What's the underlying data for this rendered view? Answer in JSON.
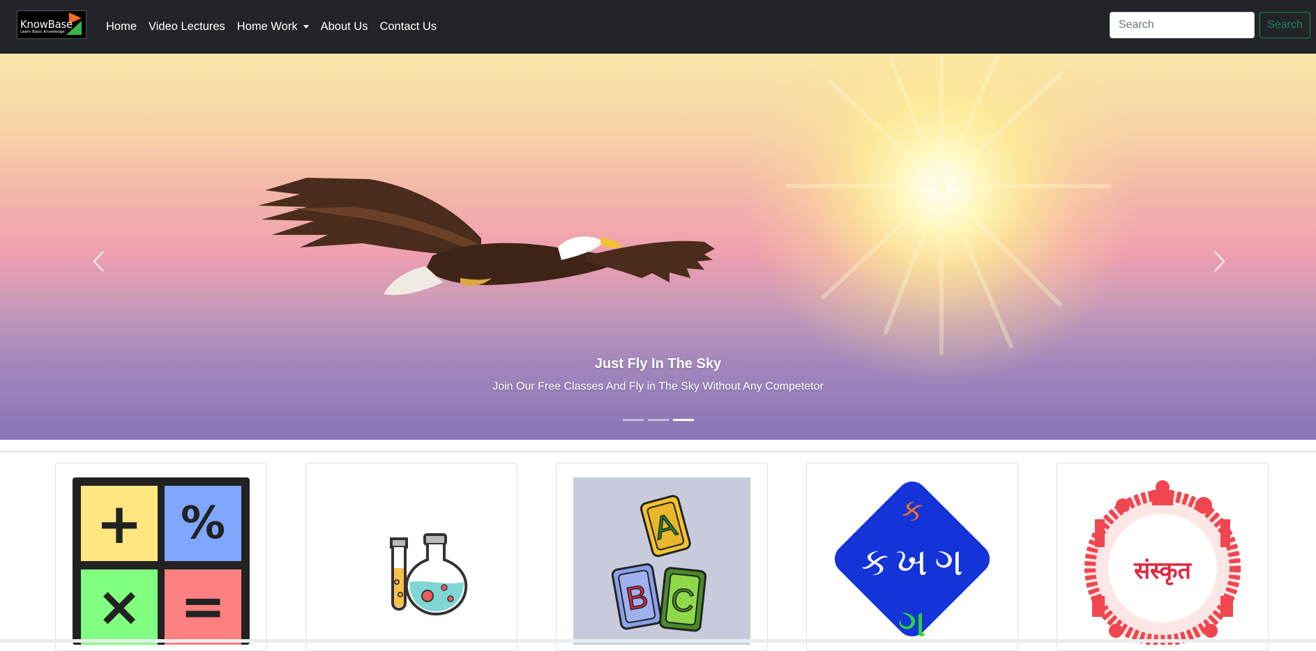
{
  "brand": {
    "name": "KnowBase",
    "tagline": "Learn Basic Knowledge",
    "colors": {
      "background": "#000000",
      "triangle_top": "#f36f21",
      "triangle_bottom": "#39b54a"
    }
  },
  "nav": {
    "items": [
      {
        "label": "Home",
        "dropdown": false
      },
      {
        "label": "Video Lectures",
        "dropdown": false
      },
      {
        "label": "Home Work",
        "dropdown": true
      },
      {
        "label": "About Us",
        "dropdown": false
      },
      {
        "label": "Contact Us",
        "dropdown": false
      }
    ]
  },
  "search": {
    "placeholder": "Search",
    "button_label": "Search"
  },
  "carousel": {
    "slide_title": "Just Fly In The Sky",
    "slide_text": "Join Our Free Classes And Fly in The Sky Without Any Competetor",
    "prev_icon": "chevron-left-icon",
    "next_icon": "chevron-right-icon",
    "indicator_count": 3,
    "active_indicator": 3
  },
  "cards": [
    {
      "subject_icon": "math-operators-icon",
      "glyphs": [
        "+",
        "%",
        "×",
        "="
      ]
    },
    {
      "subject_icon": "science-flasks-icon"
    },
    {
      "subject_icon": "abc-blocks-icon",
      "glyphs": [
        "A",
        "B",
        "C"
      ]
    },
    {
      "subject_icon": "gujarati-letters-icon",
      "glyphs": [
        "ક",
        "ખ",
        "ગ",
        "ગ"
      ]
    },
    {
      "subject_icon": "sanskrit-emblem-icon",
      "glyphs": [
        "संस्कृत"
      ]
    }
  ],
  "colors": {
    "navbar": "#212529",
    "success": "#198754",
    "math_yellow": "#ffe680",
    "math_blue": "#7fa7ff",
    "math_green": "#80ff80",
    "math_red": "#ff8080",
    "gujarati_blue": "#1433d9",
    "sanskrit_red": "#f0464f"
  }
}
